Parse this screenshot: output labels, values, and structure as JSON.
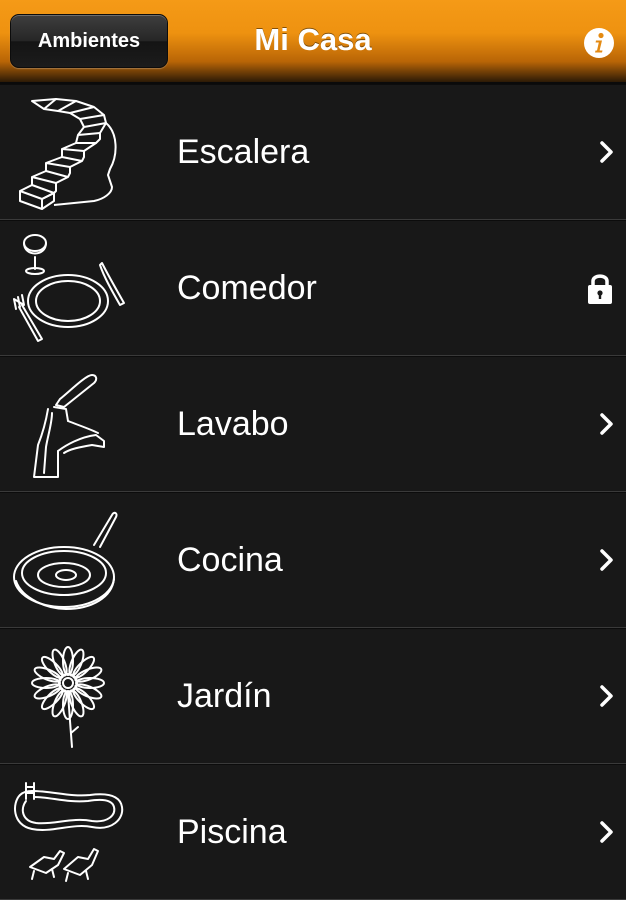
{
  "navbar": {
    "back_label": "Ambientes",
    "title": "Mi Casa",
    "info_icon": "info-icon"
  },
  "rooms": [
    {
      "label": "Escalera",
      "icon": "staircase-icon",
      "accessory": "chevron-right-icon"
    },
    {
      "label": "Comedor",
      "icon": "dining-plate-icon",
      "accessory": "lock-icon"
    },
    {
      "label": "Lavabo",
      "icon": "faucet-icon",
      "accessory": "chevron-right-icon"
    },
    {
      "label": "Cocina",
      "icon": "frying-pan-icon",
      "accessory": "chevron-right-icon"
    },
    {
      "label": "Jardín",
      "icon": "flower-icon",
      "accessory": "chevron-right-icon"
    },
    {
      "label": "Piscina",
      "icon": "pool-icon",
      "accessory": "chevron-right-icon"
    }
  ],
  "colors": {
    "navbar_accent": "#f59a17",
    "background": "#161616",
    "text": "#ffffff"
  }
}
